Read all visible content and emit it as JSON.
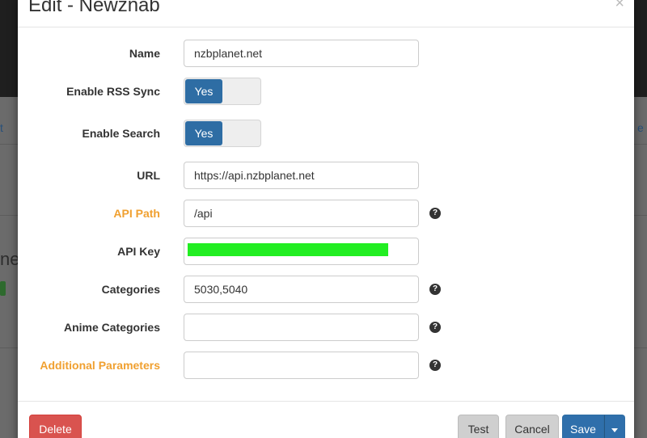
{
  "modal": {
    "title": "Edit - Newznab",
    "close_glyph": "×"
  },
  "background": {
    "left_link_fragment": "t",
    "right_link_fragment": "e",
    "left_text_fragment": "ne"
  },
  "form": {
    "name": {
      "label": "Name",
      "value": "nzbplanet.net"
    },
    "enable_rss_sync": {
      "label": "Enable RSS Sync",
      "state": "Yes"
    },
    "enable_search": {
      "label": "Enable Search",
      "state": "Yes"
    },
    "url": {
      "label": "URL",
      "value": "https://api.nzbplanet.net"
    },
    "api_path": {
      "label": "API Path",
      "value": "/api"
    },
    "api_key": {
      "label": "API Key",
      "value": ""
    },
    "categories": {
      "label": "Categories",
      "value": "5030,5040"
    },
    "anime_categories": {
      "label": "Anime Categories",
      "value": ""
    },
    "additional_parameters": {
      "label": "Additional Parameters",
      "value": ""
    },
    "help_glyph": "?"
  },
  "footer": {
    "delete_label": "Delete",
    "test_label": "Test",
    "cancel_label": "Cancel",
    "save_label": "Save"
  },
  "colors": {
    "primary": "#2e6da4",
    "danger": "#d9534f",
    "advanced_label": "#f0a030",
    "api_key_mask": "#22ee22"
  }
}
